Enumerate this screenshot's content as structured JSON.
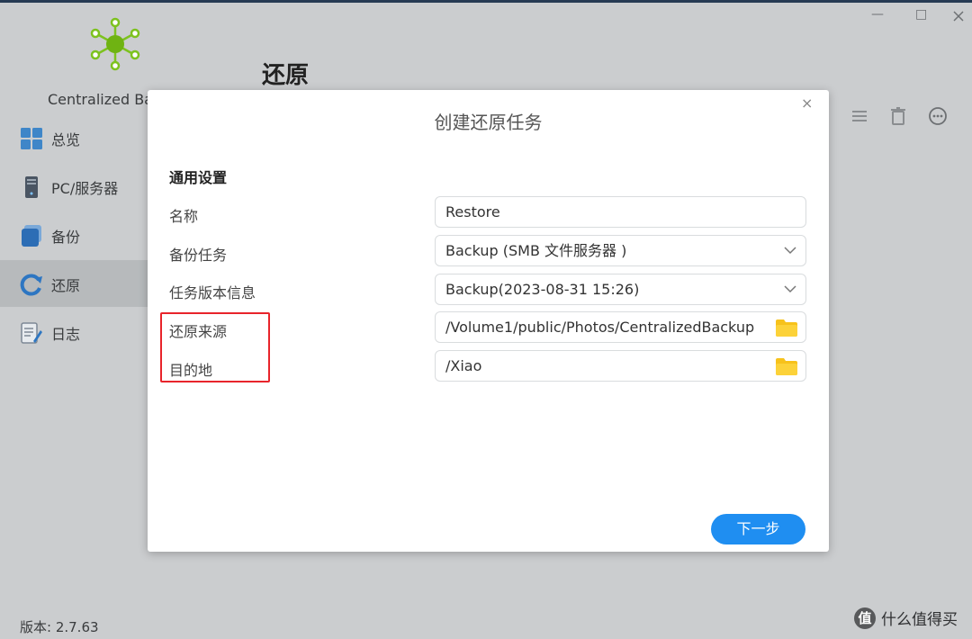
{
  "app": {
    "name": "Centralized Ba",
    "page_title": "还原",
    "version": "版本: 2.7.63"
  },
  "sidebar": {
    "items": [
      {
        "label": "总览",
        "icon": "overview-icon"
      },
      {
        "label": "PC/服务器",
        "icon": "server-icon"
      },
      {
        "label": "备份",
        "icon": "backup-icon"
      },
      {
        "label": "还原",
        "icon": "restore-icon",
        "active": true
      },
      {
        "label": "日志",
        "icon": "log-icon"
      }
    ]
  },
  "window_controls": {
    "minimize": "—",
    "maximize": "□"
  },
  "dialog": {
    "title": "创建还原任务",
    "close": "×",
    "section_title": "通用设置",
    "fields": [
      {
        "label": "名称",
        "value": "Restore",
        "type": "text"
      },
      {
        "label": "备份任务",
        "value": "Backup (SMB 文件服务器 )",
        "type": "select"
      },
      {
        "label": "任务版本信息",
        "value": "Backup(2023-08-31 15:26)",
        "type": "select"
      },
      {
        "label": "还原来源",
        "value": "/Volume1/public/Photos/CentralizedBackup",
        "type": "folder"
      },
      {
        "label": "目的地",
        "value": "/Xiao",
        "type": "folder"
      }
    ],
    "next_button": "下一步"
  },
  "watermark": {
    "badge": "值",
    "text": "什么值得买"
  },
  "colors": {
    "accent": "#1f8ef1",
    "highlight": "#e8242b",
    "folder": "#f7c21b",
    "logo": "#7dc21e"
  }
}
